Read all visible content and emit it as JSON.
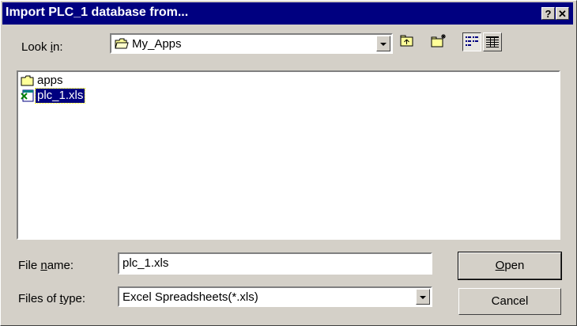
{
  "window": {
    "title": "Import PLC_1 database from...",
    "help_label": "?",
    "close_label": "✕"
  },
  "lookin": {
    "label_pre": "Look ",
    "label_u": "i",
    "label_post": "n:",
    "value": "My_Apps"
  },
  "toolbar": {
    "up_folder": "up-one-level",
    "new_folder": "create-new-folder",
    "list_view": "list-view",
    "details_view": "details-view"
  },
  "files": [
    {
      "name": "apps",
      "type": "folder",
      "selected": false
    },
    {
      "name": "plc_1.xls",
      "type": "spreadsheet",
      "selected": true
    }
  ],
  "filename": {
    "label_pre": "File ",
    "label_u": "n",
    "label_post": "ame:",
    "value": "plc_1.xls"
  },
  "filetype": {
    "label_pre": "Files of ",
    "label_u": "t",
    "label_post": "ype:",
    "value": "Excel Spreadsheets(*.xls)"
  },
  "buttons": {
    "open_u": "O",
    "open_rest": "pen",
    "cancel": "Cancel"
  },
  "colors": {
    "titlebar": "#000080",
    "face": "#d4d0c8",
    "selection": "#000080"
  }
}
